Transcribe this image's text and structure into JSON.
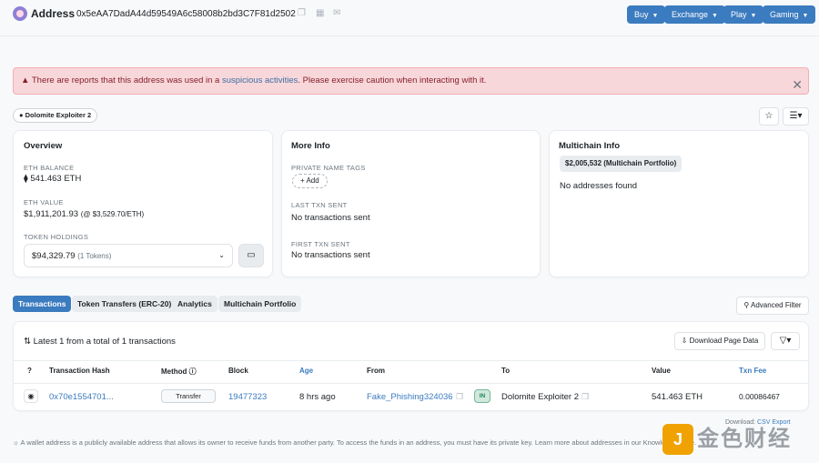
{
  "header": {
    "title": "Address",
    "address": "0x5eAA7DadA44d59549A6c58008b2bd3C7F81d2502",
    "nav": [
      {
        "label": "Buy"
      },
      {
        "label": "Exchange"
      },
      {
        "label": "Play"
      },
      {
        "label": "Gaming"
      }
    ]
  },
  "alert": {
    "prefix": "There are reports that this address was used in a",
    "link": "suspicious activities",
    "suffix": ". Please exercise caution when interacting with it."
  },
  "tag": {
    "label": "Dolomite Exploiter 2"
  },
  "overview": {
    "title": "Overview",
    "eth_balance_label": "ETH BALANCE",
    "eth_balance": "541.463 ETH",
    "eth_value_label": "ETH VALUE",
    "eth_value": "$1,911,201.93",
    "eth_price": "(@ $3,529.70/ETH)",
    "token_holdings_label": "TOKEN HOLDINGS",
    "token_holdings": "$94,329.79",
    "token_count": "(1 Tokens)"
  },
  "more_info": {
    "title": "More Info",
    "private_tags_label": "PRIVATE NAME TAGS",
    "add_label": "+ Add",
    "last_txn_label": "LAST TXN SENT",
    "last_txn": "No transactions sent",
    "first_txn_label": "FIRST TXN SENT",
    "first_txn": "No transactions sent"
  },
  "multichain": {
    "title": "Multichain Info",
    "portfolio": "$2,005,532 (Multichain Portfolio)",
    "empty": "No addresses found"
  },
  "tabs": [
    {
      "label": "Transactions",
      "active": true
    },
    {
      "label": "Token Transfers (ERC-20)",
      "active": false
    },
    {
      "label": "Analytics",
      "active": false
    },
    {
      "label": "Multichain Portfolio",
      "active": false
    }
  ],
  "advanced_filter": "Advanced Filter",
  "table": {
    "summary": "Latest 1 from a total of 1 transactions",
    "download_label": "Download Page Data",
    "columns": {
      "hash": "Transaction Hash",
      "method": "Method",
      "block": "Block",
      "age": "Age",
      "from": "From",
      "to": "To",
      "value": "Value",
      "fee": "Txn Fee"
    },
    "rows": [
      {
        "hash": "0x70e1554701...",
        "method": "Transfer",
        "block": "19477323",
        "age": "8 hrs ago",
        "from": "Fake_Phishing324036",
        "direction": "IN",
        "to": "Dolomite Exploiter 2",
        "value": "541.463 ETH",
        "fee": "0.00086467"
      }
    ]
  },
  "download": {
    "prefix": "Download:",
    "link": "CSV Export"
  },
  "footer": "A wallet address is a publicly available address that allows its owner to receive funds from another party. To access the funds in an address, you must have its private key. Learn more about addresses in our Knowledge Base.",
  "colors": {
    "primary": "#3b7bbf",
    "alert_bg": "#f8d7da",
    "alert_text": "#842029"
  }
}
